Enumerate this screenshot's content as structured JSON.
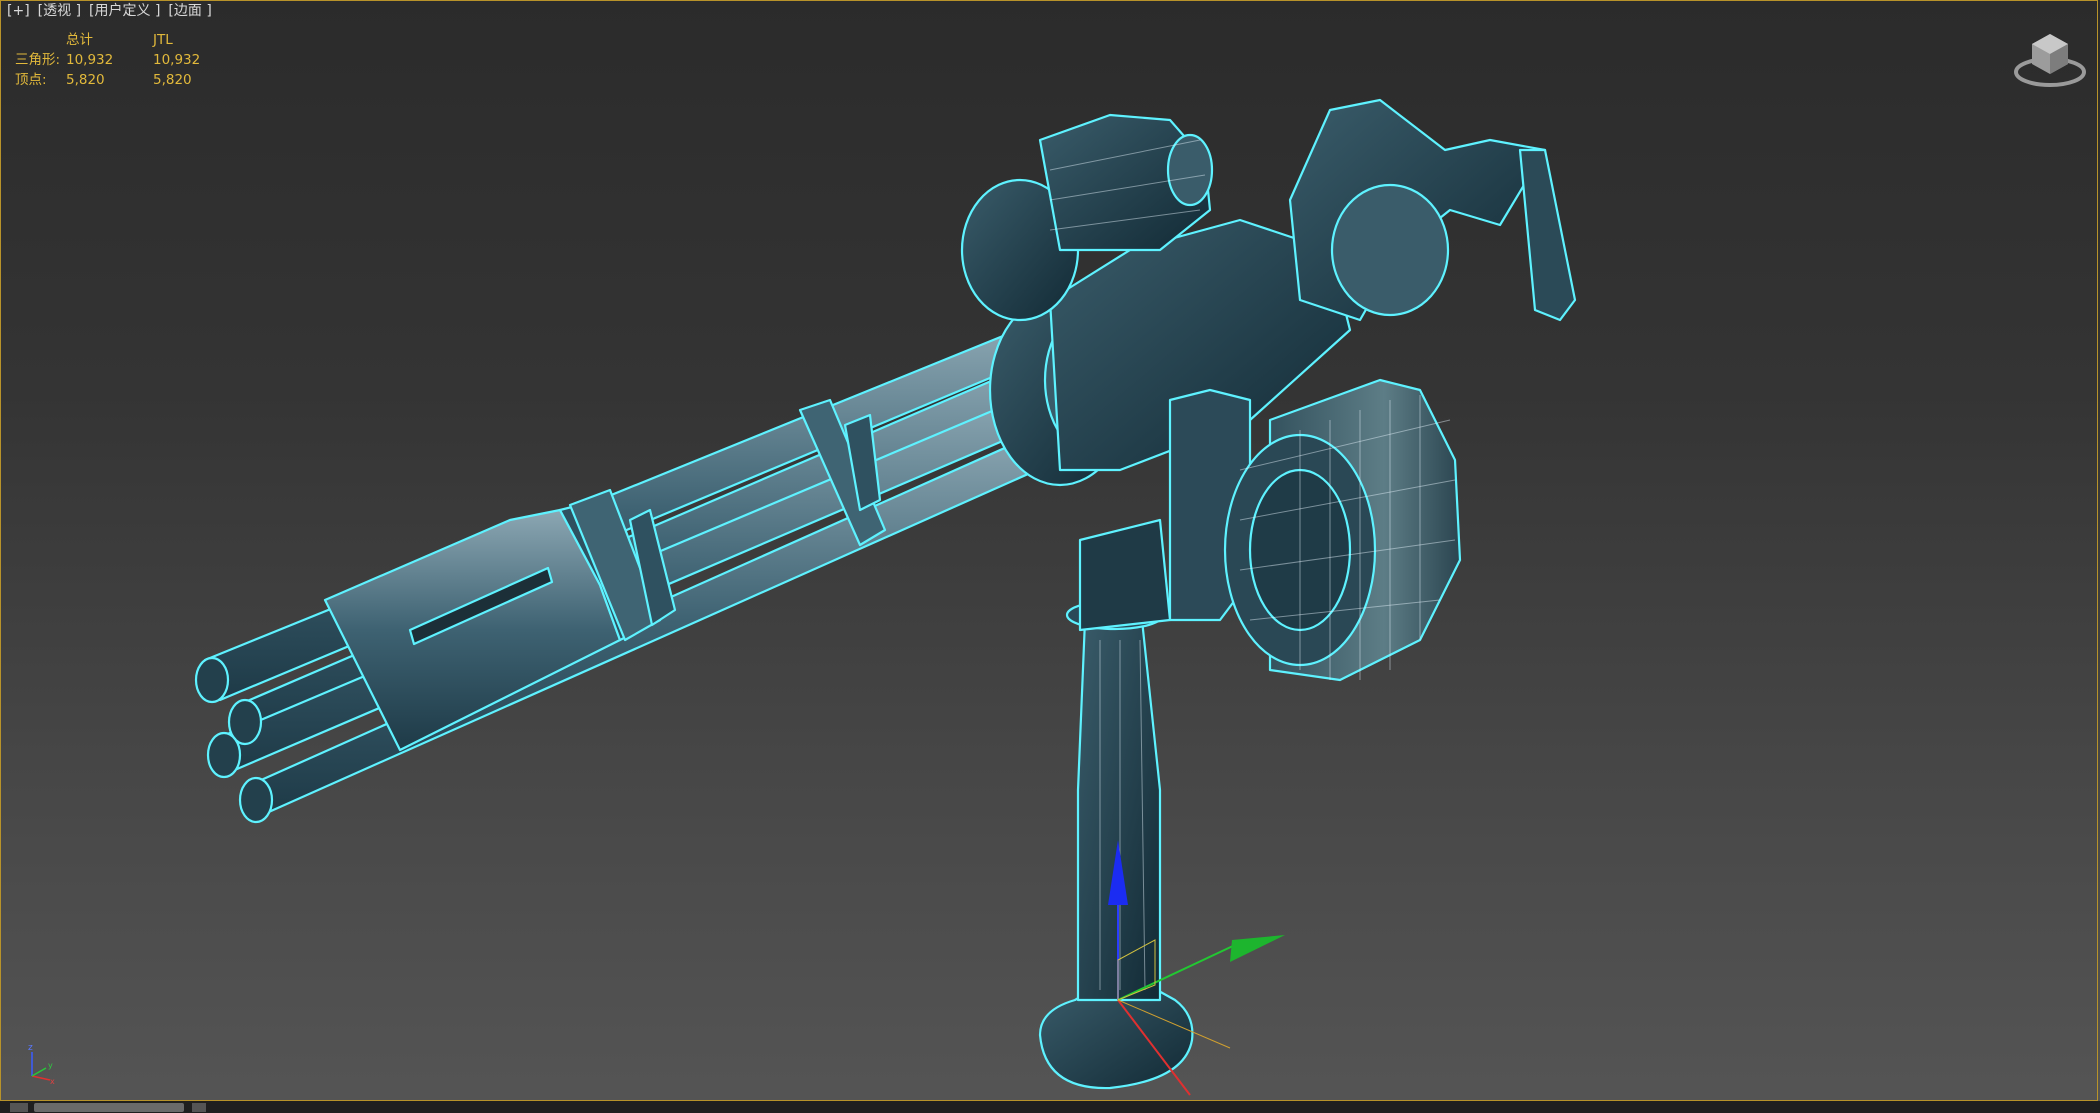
{
  "viewport": {
    "labels": {
      "plus": "[+]",
      "view": "[透视 ]",
      "shading": "[用户定义 ]",
      "edges": "[边面 ]"
    }
  },
  "statistics": {
    "header": {
      "blank": "",
      "total": "总计",
      "selected": "JTL"
    },
    "rows": [
      {
        "label": "三角形:",
        "total": "10,932",
        "selected": "10,932"
      },
      {
        "label": "顶点:",
        "total": "5,820",
        "selected": "5,820"
      }
    ]
  },
  "colors": {
    "stats_text": "#e2b93b",
    "selection_outline": "#5ef2ff",
    "model_fill": "#2c4a58",
    "frame_border": "#b8932a"
  },
  "icons": {
    "viewcube": "viewcube-icon",
    "gizmo": "transform-gizmo-icon",
    "triad": "axis-triad-icon"
  },
  "axis_labels": {
    "z": "z",
    "x": "x",
    "y": "y"
  }
}
